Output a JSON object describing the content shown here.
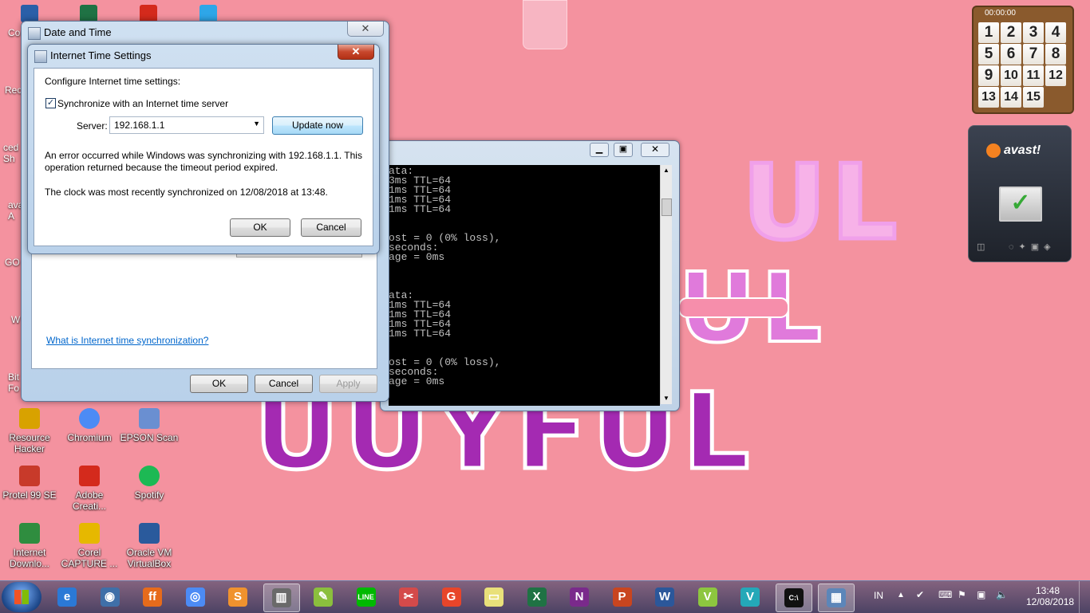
{
  "desktop": {
    "icons": [
      {
        "label": "Resource Hacker",
        "color": "#d8a200"
      },
      {
        "label": "Chromium",
        "color": "#4c8bf5"
      },
      {
        "label": "EPSON Scan",
        "color": "#6a8fd1"
      },
      {
        "label": "Protel 99 SE",
        "color": "#c83a2a"
      },
      {
        "label": "Adobe Creati...",
        "color": "#d42a1c"
      },
      {
        "label": "Spotify",
        "color": "#1db954"
      },
      {
        "label": "Internet Downlo...",
        "color": "#2f8d3f"
      },
      {
        "label": "Corel CAPTURE ...",
        "color": "#e6b800"
      },
      {
        "label": "Oracle VM VirtualBox",
        "color": "#2a5a9c"
      }
    ],
    "clipped_labels": [
      "Co",
      "Rec",
      "ced Sh",
      "ava A",
      "GO",
      "W",
      "Bit Fo"
    ]
  },
  "wallpaper": {
    "word_top": "UL",
    "word_mid": "UL",
    "word_bottom": "UUYFUL"
  },
  "date_time_window": {
    "title": "Date and Time",
    "close_label": "✕",
    "link": "What is Internet time synchronization?",
    "ok": "OK",
    "cancel": "Cancel",
    "apply": "Apply"
  },
  "internet_time_dialog": {
    "title": "Internet Time Settings",
    "close_label": "✕",
    "configure_label": "Configure Internet time settings:",
    "sync_checkbox_label": "Synchronize with an Internet time server",
    "sync_checked": true,
    "server_label": "Server:",
    "server_value": "192.168.1.1",
    "update_button": "Update now",
    "error_message": "An error occurred while Windows was synchronizing with 192.168.1.1.  This operation returned because the timeout period expired.",
    "last_sync_message": "The clock was most recently synchronized on 12/08/2018 at 13:48.",
    "ok": "OK",
    "cancel": "Cancel"
  },
  "cmd_window": {
    "lines": [
      "ata:",
      "3ms TTL=64",
      "1ms TTL=64",
      "1ms TTL=64",
      "1ms TTL=64",
      "",
      "",
      "ost = 0 (0% loss),",
      "seconds:",
      "age = 0ms",
      "",
      "",
      "",
      "ata:",
      "1ms TTL=64",
      "1ms TTL=64",
      "1ms TTL=64",
      "1ms TTL=64",
      "",
      "",
      "ost = 0 (0% loss),",
      "seconds:",
      "age = 0ms"
    ]
  },
  "gadgets": {
    "puzzle_timer": "00:00:00",
    "puzzle_tiles": [
      "1",
      "2",
      "3",
      "4",
      "5",
      "6",
      "7",
      "8",
      "9",
      "10",
      "11",
      "12",
      "13",
      "14",
      "15"
    ],
    "avast_brand": "avast!"
  },
  "taskbar": {
    "apps": [
      {
        "name": "internet-explorer",
        "glyph": "e",
        "color": "#2b79d6"
      },
      {
        "name": "media-center",
        "glyph": "◉",
        "color": "#3f6fa8"
      },
      {
        "name": "firefox",
        "glyph": "ff",
        "color": "#e76b1b"
      },
      {
        "name": "chrome",
        "glyph": "◎",
        "color": "#4c8bf5"
      },
      {
        "name": "sublime-text",
        "glyph": "S",
        "color": "#f0922e"
      },
      {
        "name": "library",
        "glyph": "▥",
        "color": "#6a6a6a"
      },
      {
        "name": "notepad-plus-plus",
        "glyph": "✎",
        "color": "#8bbf3d"
      },
      {
        "name": "line",
        "glyph": "LINE",
        "color": "#00b900"
      },
      {
        "name": "snipping-tool",
        "glyph": "✂",
        "color": "#d44a4a"
      },
      {
        "name": "gom-player",
        "glyph": "G",
        "color": "#e8452a"
      },
      {
        "name": "sticky-notes",
        "glyph": "▭",
        "color": "#e9e07a"
      },
      {
        "name": "excel",
        "glyph": "X",
        "color": "#1f7244"
      },
      {
        "name": "onenote",
        "glyph": "N",
        "color": "#7a2a8b"
      },
      {
        "name": "powerpoint",
        "glyph": "P",
        "color": "#c9451f"
      },
      {
        "name": "word",
        "glyph": "W",
        "color": "#2b579a"
      },
      {
        "name": "vivaldi-1",
        "glyph": "V",
        "color": "#8dc63f"
      },
      {
        "name": "vivaldi-2",
        "glyph": "V",
        "color": "#24a8b8"
      },
      {
        "name": "command-prompt",
        "glyph": "C:\\",
        "color": "#111111"
      },
      {
        "name": "date-time-control-panel",
        "glyph": "▦",
        "color": "#5c86b9"
      }
    ],
    "language": "IN",
    "time": "13:48",
    "date": "12/08/2018"
  }
}
